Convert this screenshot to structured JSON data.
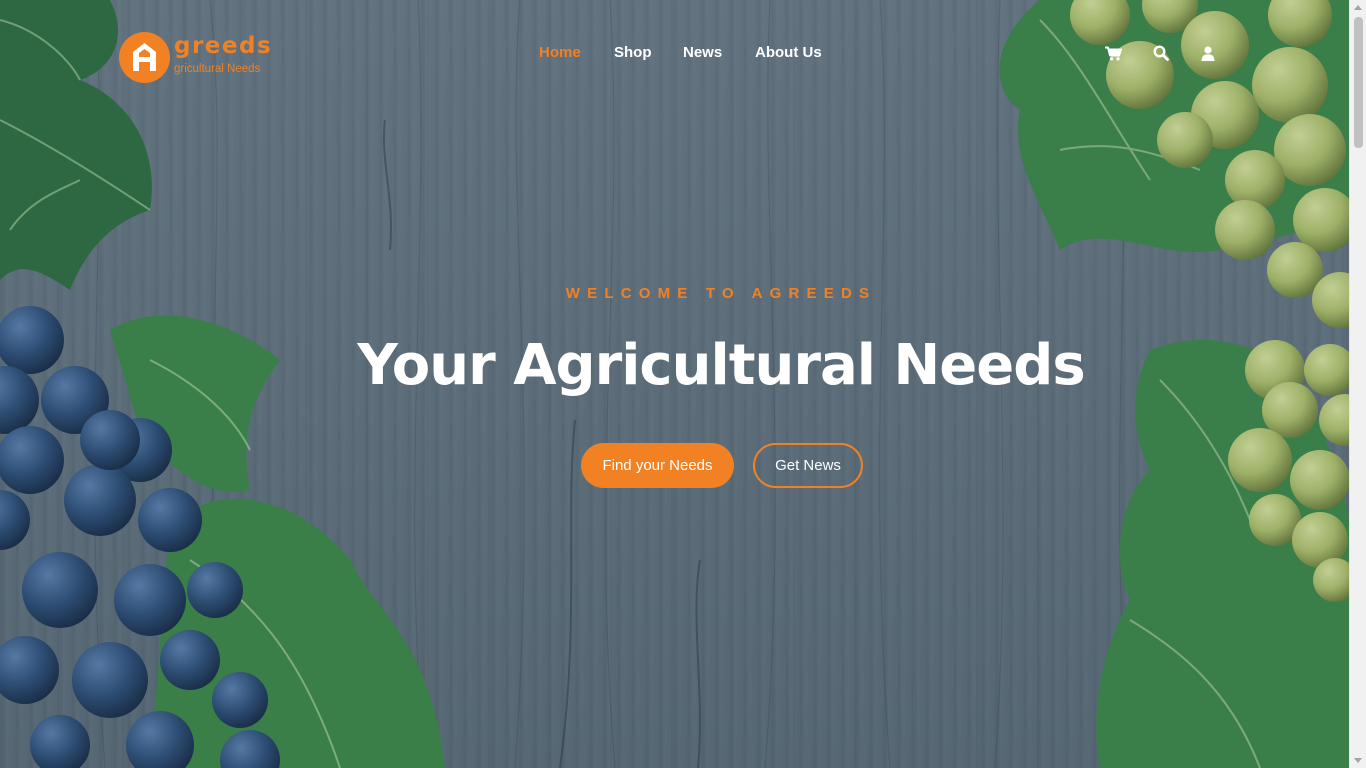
{
  "brand": {
    "logo_word": "greeds",
    "logo_tagline": "gricultural Needs",
    "accent_color": "#f28123"
  },
  "nav": {
    "items": [
      {
        "label": "Home",
        "active": true
      },
      {
        "label": "Shop",
        "active": false
      },
      {
        "label": "News",
        "active": false
      },
      {
        "label": "About Us",
        "active": false
      }
    ],
    "icons": [
      "shopping-cart-icon",
      "search-icon",
      "user-icon"
    ]
  },
  "hero": {
    "kicker": "WELCOME TO AGREEDS",
    "title": "Your Agricultural Needs",
    "primary_button": "Find your Needs",
    "secondary_button": "Get News"
  }
}
